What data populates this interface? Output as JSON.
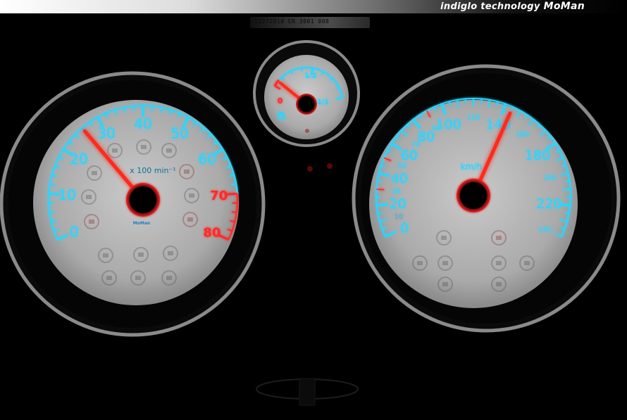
{
  "header": {
    "brand_prefix": "indiglo technology",
    "brand_name": "MoMan"
  },
  "part_label": "13272018 ER 3001 008",
  "tachometer": {
    "unit_label": "x 100 min⁻¹",
    "logo": "MoMan",
    "min": 0,
    "max": 80,
    "major_labels": [
      "0",
      "10",
      "20",
      "30",
      "40",
      "50",
      "60",
      "70",
      "80"
    ],
    "redline_start": 70,
    "needle_value": 26
  },
  "fuel_gauge": {
    "labels": [
      "0",
      "1/2",
      "1/1"
    ],
    "needle_fraction": 0.05,
    "icon": "fuel-pump-icon"
  },
  "speedometer": {
    "unit_label": "km/h",
    "min": 0,
    "max": 240,
    "major_labels": [
      "0",
      "20",
      "40",
      "60",
      "80",
      "100",
      "140",
      "180",
      "220"
    ],
    "minor_labels": [
      "10",
      "30",
      "50",
      "70",
      "90",
      "120",
      "160",
      "200",
      "240"
    ],
    "needle_value": 145
  },
  "warning_icons": {
    "tachometer": [
      "oil-pressure-icon",
      "battery-icon",
      "glow-plug-icon",
      "esp-icon",
      "fog-light-icon",
      "door-icon",
      "seatbelt-icon",
      "airbag-icon",
      "abs-icon",
      "engine-icon"
    ],
    "speedometer": [
      "check-engine-icon",
      "brake-icon",
      "tpms-icon",
      "cruise-icon",
      "high-beam-icon",
      "service-icon",
      "traction-icon"
    ]
  },
  "colors": {
    "backlight": "#2ad5ff",
    "needle": "#ff2a1a",
    "redline": "#ff2a2a",
    "dial_face": "#b6b6b6"
  }
}
